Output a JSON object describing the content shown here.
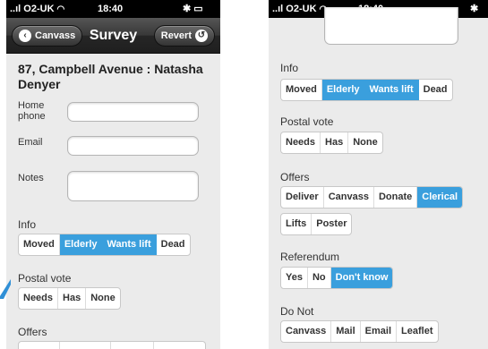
{
  "left": {
    "status": {
      "carrier": "O2-UK",
      "time": "18:40"
    },
    "nav": {
      "back": "Canvass",
      "title": "Survey",
      "revert": "Revert"
    },
    "address": "87, Campbell Avenue : Natasha Denyer",
    "fields": {
      "home_phone": "Home phone",
      "email": "Email",
      "notes": "Notes"
    },
    "info": {
      "label": "Info",
      "options": [
        "Moved",
        "Elderly",
        "Wants lift",
        "Dead"
      ]
    },
    "postal": {
      "label": "Postal vote",
      "options": [
        "Needs",
        "Has",
        "None"
      ]
    },
    "offers": {
      "label": "Offers"
    }
  },
  "right": {
    "status": {
      "carrier": "O2-UK",
      "time": "18:40"
    },
    "info": {
      "label": "Info",
      "options": [
        "Moved",
        "Elderly",
        "Wants lift",
        "Dead"
      ]
    },
    "postal": {
      "label": "Postal vote",
      "options": [
        "Needs",
        "Has",
        "None"
      ]
    },
    "offers": {
      "label": "Offers",
      "row1": [
        "Deliver",
        "Canvass",
        "Donate",
        "Clerical"
      ],
      "row2": [
        "Lifts",
        "Poster"
      ]
    },
    "referendum": {
      "label": "Referendum",
      "options": [
        "Yes",
        "No",
        "Don't know"
      ]
    },
    "donot": {
      "label": "Do Not",
      "options": [
        "Canvass",
        "Mail",
        "Email",
        "Leaflet"
      ]
    }
  },
  "colors": {
    "accent": "#3a9fdd",
    "background": "#ebebeb",
    "navbar": "#262626"
  }
}
